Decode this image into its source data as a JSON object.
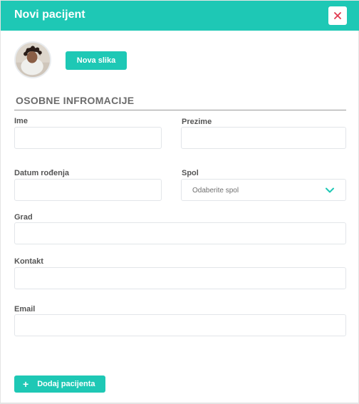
{
  "header": {
    "title": "Novi pacijent",
    "close_icon": "close-icon"
  },
  "photo": {
    "button_label": "Nova slika"
  },
  "section": {
    "title": "OSOBNE INFROMACIJE"
  },
  "form": {
    "first_name": {
      "label": "Ime",
      "value": ""
    },
    "last_name": {
      "label": "Prezime",
      "value": ""
    },
    "birth_date": {
      "label": "Datum rođenja",
      "value": ""
    },
    "gender": {
      "label": "Spol",
      "placeholder": "Odaberite spol"
    },
    "city": {
      "label": "Grad",
      "value": ""
    },
    "contact": {
      "label": "Kontakt",
      "value": ""
    },
    "email": {
      "label": "Email",
      "value": ""
    }
  },
  "actions": {
    "add_label": "Dodaj pacijenta",
    "add_icon": "plus-icon"
  },
  "colors": {
    "accent": "#1ec8b5",
    "close_x": "#e0394f"
  }
}
